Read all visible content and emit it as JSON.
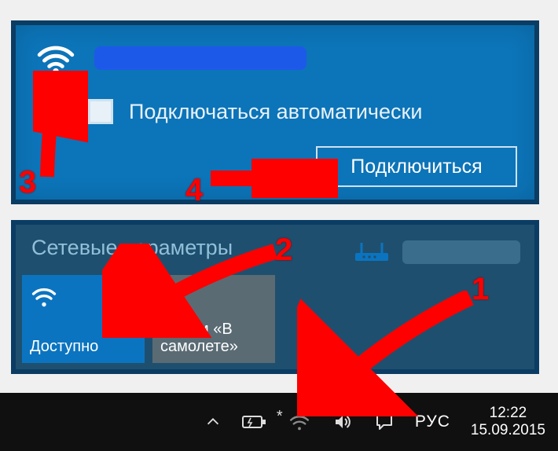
{
  "network": {
    "auto_connect_label": "Подключаться автоматически",
    "connect_button": "Подключиться"
  },
  "settings": {
    "heading": "Сетевые параметры",
    "wifi_tile": "Доступно",
    "airplane_tile": "Режим «В самолете»"
  },
  "taskbar": {
    "language": "РУС",
    "time": "12:22",
    "date": "15.09.2015"
  },
  "annotations": {
    "m1": "1",
    "m2": "2",
    "m3": "3",
    "m4": "4"
  }
}
